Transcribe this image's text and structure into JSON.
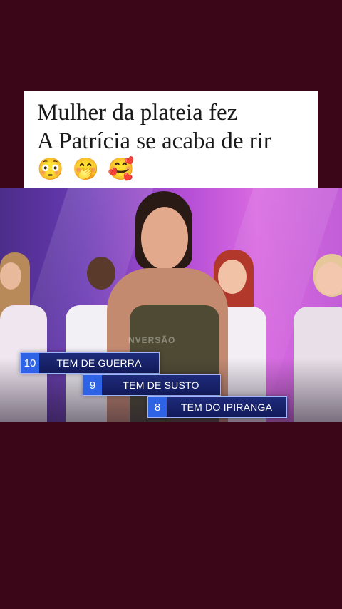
{
  "caption": {
    "line1": "Mulher da plateia fez",
    "line2": "A Patrícia se acaba de rir",
    "emojis": [
      "😳",
      "🤭",
      "🥰"
    ]
  },
  "video": {
    "watermark": "NVERSÃO",
    "answers": [
      {
        "rank": "10",
        "label": "TEM DE GUERRA"
      },
      {
        "rank": "9",
        "label": "TEM DE SUSTO"
      },
      {
        "rank": "8",
        "label": "TEM DO IPIRANGA"
      }
    ]
  },
  "colors": {
    "background": "#3a0618",
    "caption_bg": "#ffffff",
    "badge_blue": "#2e63e6",
    "label_navy": "#1e2b7a"
  }
}
